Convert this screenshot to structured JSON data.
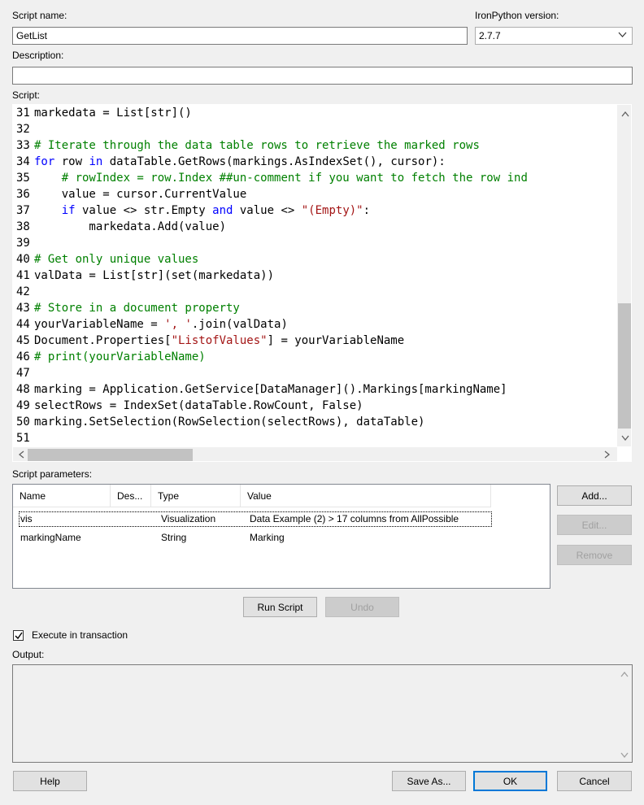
{
  "script_name": {
    "label": "Script name:",
    "value": "GetList"
  },
  "ironpython": {
    "label": "IronPython version:",
    "value": "2.7.7"
  },
  "description": {
    "label": "Description:",
    "value": ""
  },
  "script_label": "Script:",
  "code_lines": [
    {
      "n": "31",
      "parts": [
        [
          "",
          "markedata = List[str]()"
        ]
      ]
    },
    {
      "n": "32",
      "parts": []
    },
    {
      "n": "33",
      "parts": [
        [
          "cm",
          "# Iterate through the data table rows to retrieve the marked rows"
        ]
      ]
    },
    {
      "n": "34",
      "parts": [
        [
          "kw",
          "for"
        ],
        [
          "",
          " row "
        ],
        [
          "kw",
          "in"
        ],
        [
          "",
          " dataTable.GetRows(markings.AsIndexSet(), cursor):"
        ]
      ]
    },
    {
      "n": "35",
      "parts": [
        [
          "",
          "    "
        ],
        [
          "cm",
          "# rowIndex = row.Index ##un-comment if you want to fetch the row ind"
        ]
      ]
    },
    {
      "n": "36",
      "parts": [
        [
          "",
          "    value = cursor.CurrentValue"
        ]
      ]
    },
    {
      "n": "37",
      "parts": [
        [
          "",
          "    "
        ],
        [
          "kw",
          "if"
        ],
        [
          "",
          " value <> str.Empty "
        ],
        [
          "kw",
          "and"
        ],
        [
          "",
          " value <> "
        ],
        [
          "st",
          "\"(Empty)\""
        ],
        [
          "",
          ":"
        ]
      ]
    },
    {
      "n": "38",
      "parts": [
        [
          "",
          "        markedata.Add(value)"
        ]
      ]
    },
    {
      "n": "39",
      "parts": []
    },
    {
      "n": "40",
      "parts": [
        [
          "cm",
          "# Get only unique values"
        ]
      ]
    },
    {
      "n": "41",
      "parts": [
        [
          "",
          "valData = List[str](set(markedata))"
        ]
      ]
    },
    {
      "n": "42",
      "parts": []
    },
    {
      "n": "43",
      "parts": [
        [
          "cm",
          "# Store in a document property"
        ]
      ]
    },
    {
      "n": "44",
      "parts": [
        [
          "",
          "yourVariableName = "
        ],
        [
          "st",
          "', '"
        ],
        [
          "",
          ".join(valData)"
        ]
      ]
    },
    {
      "n": "45",
      "parts": [
        [
          "",
          "Document.Properties["
        ],
        [
          "st",
          "\"ListofValues\""
        ],
        [
          "",
          "] = yourVariableName"
        ]
      ]
    },
    {
      "n": "46",
      "parts": [
        [
          "cm",
          "# print(yourVariableName)"
        ]
      ]
    },
    {
      "n": "47",
      "parts": []
    },
    {
      "n": "48",
      "parts": [
        [
          "",
          "marking = Application.GetService[DataManager]().Markings[markingName]"
        ]
      ]
    },
    {
      "n": "49",
      "parts": [
        [
          "",
          "selectRows = IndexSet(dataTable.RowCount, False)"
        ]
      ]
    },
    {
      "n": "50",
      "parts": [
        [
          "",
          "marking.SetSelection(RowSelection(selectRows), dataTable)"
        ]
      ]
    },
    {
      "n": "51",
      "parts": []
    }
  ],
  "params": {
    "label": "Script parameters:",
    "columns": [
      "Name",
      "Des...",
      "Type",
      "Value"
    ],
    "rows": [
      {
        "name": "vis",
        "desc": "",
        "type": "Visualization",
        "value": "Data Example (2) > 17 columns from AllPossible"
      },
      {
        "name": "markingName",
        "desc": "",
        "type": "String",
        "value": "Marking"
      }
    ]
  },
  "buttons": {
    "add": "Add...",
    "edit": "Edit...",
    "remove": "Remove",
    "run_script": "Run Script",
    "undo": "Undo",
    "help": "Help",
    "save_as": "Save As...",
    "ok": "OK",
    "cancel": "Cancel"
  },
  "execute_transaction": {
    "label": "Execute in transaction",
    "checked": true
  },
  "output": {
    "label": "Output:",
    "value": ""
  }
}
